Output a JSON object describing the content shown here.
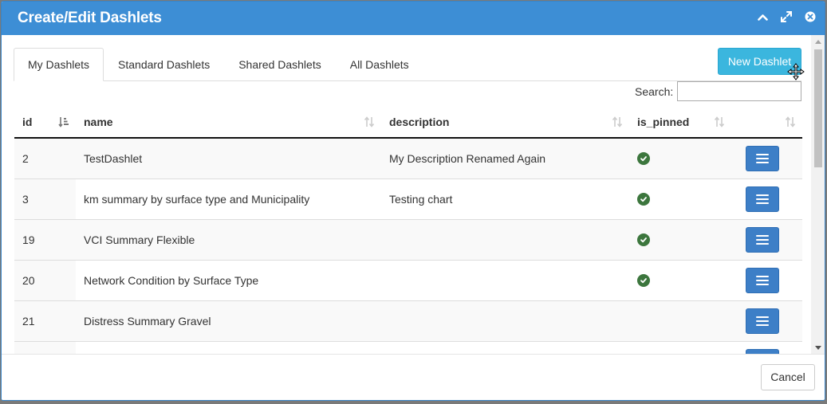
{
  "dialog": {
    "title": "Create/Edit Dashlets"
  },
  "tabs": [
    {
      "label": "My Dashlets",
      "active": true
    },
    {
      "label": "Standard Dashlets",
      "active": false
    },
    {
      "label": "Shared Dashlets",
      "active": false
    },
    {
      "label": "All Dashlets",
      "active": false
    }
  ],
  "toolbar": {
    "new_label": "New Dashlet"
  },
  "search": {
    "label": "Search:",
    "value": ""
  },
  "table": {
    "columns": [
      "id",
      "name",
      "description",
      "is_pinned",
      ""
    ],
    "rows": [
      {
        "id": "2",
        "name": "TestDashlet",
        "description": "My Description Renamed Again",
        "is_pinned": true
      },
      {
        "id": "3",
        "name": "km summary by surface type and Municipality",
        "description": "Testing chart",
        "is_pinned": true
      },
      {
        "id": "19",
        "name": "VCI Summary Flexible",
        "description": "",
        "is_pinned": true
      },
      {
        "id": "20",
        "name": "Network Condition by Surface Type",
        "description": "",
        "is_pinned": true
      },
      {
        "id": "21",
        "name": "Distress Summary Gravel",
        "description": "",
        "is_pinned": false
      },
      {
        "id": "",
        "name": "",
        "description": "",
        "is_pinned": false
      }
    ]
  },
  "footer": {
    "cancel_label": "Cancel"
  },
  "colors": {
    "header_bg": "#3d8ed5",
    "new_button": "#3bb6de",
    "action_button": "#3d7fc7",
    "pinned_check": "#3c763d"
  },
  "icons": {
    "collapse": "chevron-up-icon",
    "maximize": "expand-icon",
    "close": "close-circle-icon",
    "sort_active": "sort-amount-asc-icon",
    "sort": "sort-icon",
    "pinned": "check-circle-icon",
    "row_menu": "bars-icon"
  }
}
